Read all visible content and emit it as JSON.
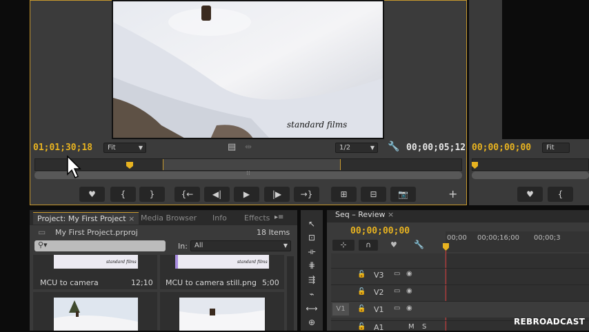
{
  "source_monitor": {
    "timecode": "01;01;30;18",
    "fit": "Fit",
    "resolution": "1/2",
    "duration": "00;00;05;12",
    "watermark": "standard films"
  },
  "program_monitor": {
    "timecode": "00;00;00;00",
    "fit": "Fit"
  },
  "transport": {
    "marker": "♥",
    "mark_in": "{",
    "mark_out": "}",
    "go_in": "{←",
    "step_back": "◀|",
    "play": "▶",
    "step_fwd": "|▶",
    "go_out": "→}",
    "insert": "⊞",
    "overwrite": "⊟",
    "export_frame": "📷",
    "add": "+"
  },
  "project": {
    "tabs": [
      "Project: My First Project",
      "Media Browser",
      "Info",
      "Effects"
    ],
    "file": "My First Project.prproj",
    "items": "18 Items",
    "search_placeholder": "",
    "in_label": "In:",
    "in_value": "All",
    "clips": [
      {
        "name": "MCU to camera",
        "duration": "12;10"
      },
      {
        "name": "MCU to camera still.png",
        "duration": "5;00"
      }
    ]
  },
  "sequence": {
    "tab": "Seq – Review",
    "timecode": "00;00;00;00",
    "ruler": [
      "00;00",
      "00;00;16;00",
      "00;00;3"
    ],
    "tracks": [
      "V3",
      "V2",
      "V1"
    ],
    "source_patch": "V1",
    "audio_track": "A1",
    "audio_m": "M",
    "audio_s": "S"
  },
  "watermark": "REBROADCAST",
  "colors": {
    "accent": "#e8b320",
    "panel": "#3a3a3a",
    "playhead": "#d83a3a"
  }
}
